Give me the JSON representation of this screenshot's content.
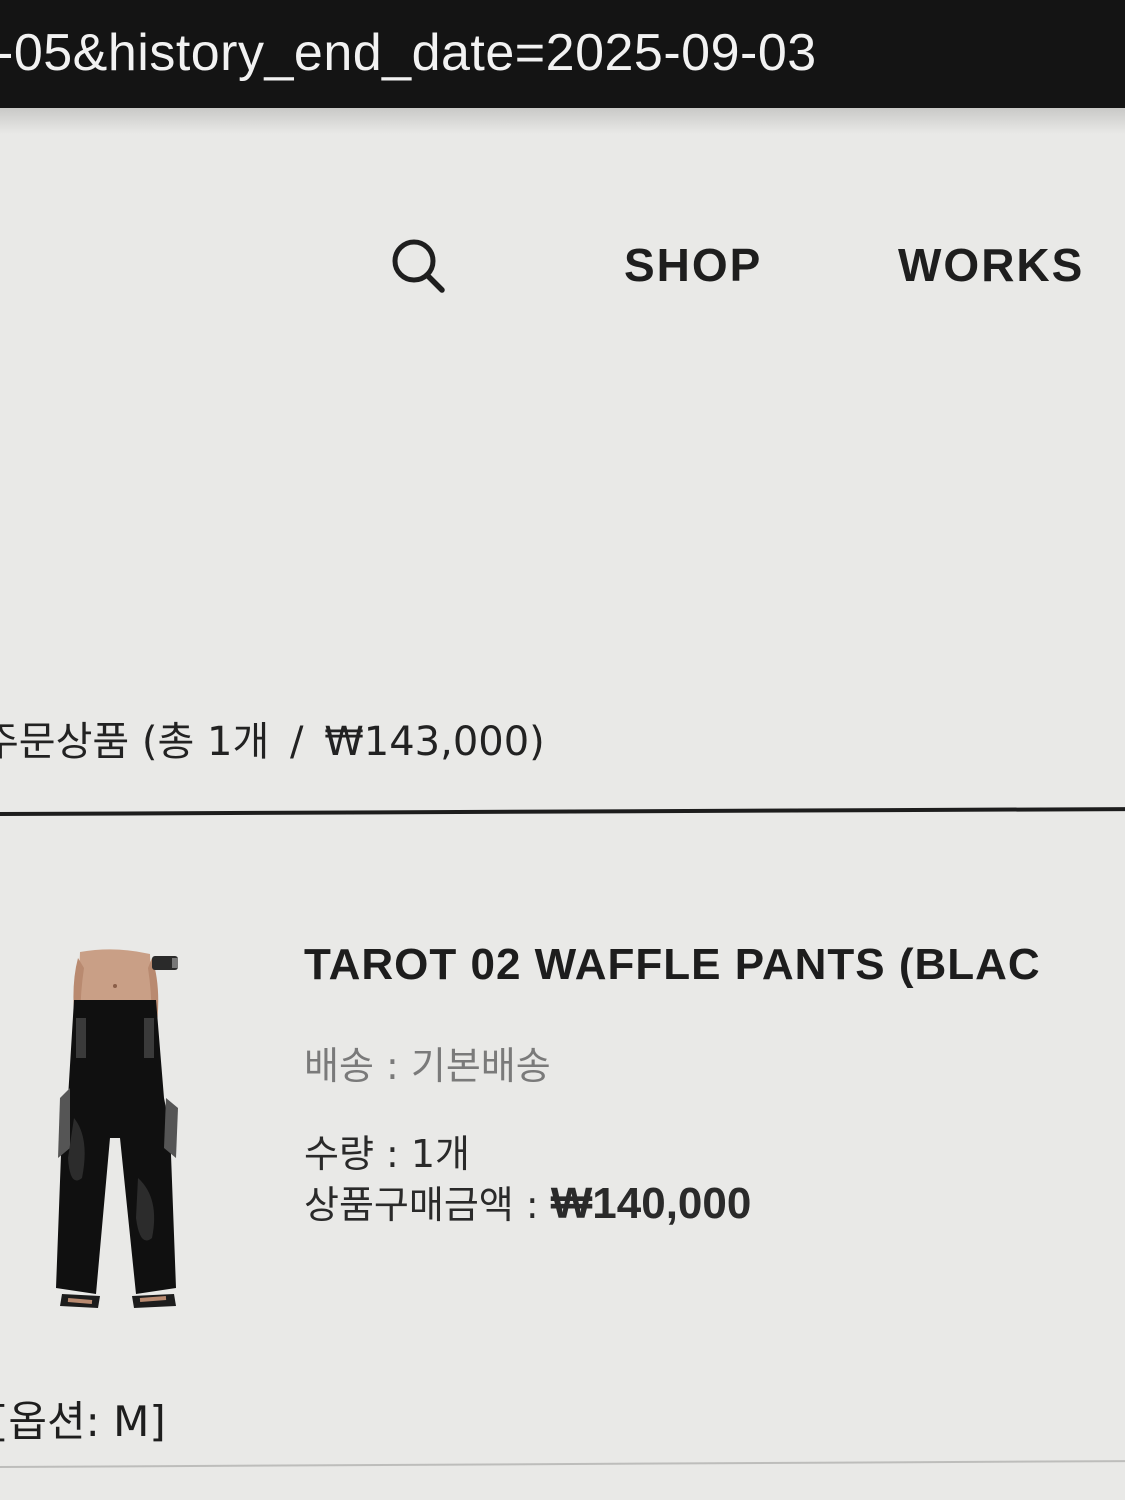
{
  "browser": {
    "url_fragment": "-05&history_end_date=2025-09-03"
  },
  "nav": {
    "search_icon": "search-icon",
    "shop_label": "SHOP",
    "works_label": "WORKS"
  },
  "order": {
    "section_label": "주문상품",
    "summary_open": "(총 1개",
    "summary_separator": "/",
    "summary_total": "₩143,000)"
  },
  "product": {
    "name": "TAROT 02 WAFFLE PANTS (BLAC",
    "image_icon": "product-thumbnail-black-pants",
    "shipping_label": "배송 : 기본배송",
    "quantity_label": "수량 : 1개",
    "price_label": "상품구매금액 :",
    "price_value": "₩140,000",
    "option_label": "[옵션: M]"
  },
  "colors": {
    "url_bar": "#141414",
    "background": "#e9e9e7",
    "text": "#1a1a1a",
    "muted_text": "#7a7a7a"
  }
}
